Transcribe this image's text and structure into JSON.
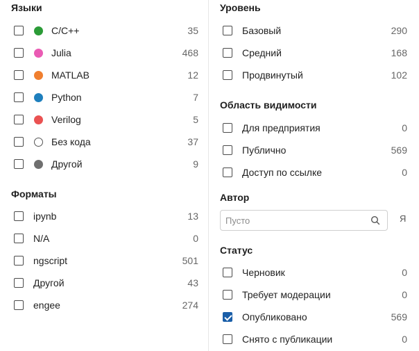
{
  "languages": {
    "title": "Языки",
    "items": [
      {
        "label": "C/C++",
        "count": "35",
        "color": "#2b9b37"
      },
      {
        "label": "Julia",
        "count": "468",
        "color": "#ea5bb4"
      },
      {
        "label": "MATLAB",
        "count": "12",
        "color": "#f07f2f"
      },
      {
        "label": "Python",
        "count": "7",
        "color": "#1e7fbd"
      },
      {
        "label": "Verilog",
        "count": "5",
        "color": "#ea5252"
      },
      {
        "label": "Без кода",
        "count": "37",
        "color": "#ffffff"
      },
      {
        "label": "Другой",
        "count": "9",
        "color": "#6f6f6f"
      }
    ]
  },
  "formats": {
    "title": "Форматы",
    "items": [
      {
        "label": "ipynb",
        "count": "13"
      },
      {
        "label": "N/A",
        "count": "0"
      },
      {
        "label": "ngscript",
        "count": "501"
      },
      {
        "label": "Другой",
        "count": "43"
      },
      {
        "label": "engee",
        "count": "274"
      }
    ]
  },
  "level": {
    "title": "Уровень",
    "items": [
      {
        "label": "Базовый",
        "count": "290"
      },
      {
        "label": "Средний",
        "count": "168"
      },
      {
        "label": "Продвинутый",
        "count": "102"
      }
    ]
  },
  "visibility": {
    "title": "Область видимости",
    "items": [
      {
        "label": "Для предприятия",
        "count": "0"
      },
      {
        "label": "Публично",
        "count": "569"
      },
      {
        "label": "Доступ по ссылке",
        "count": "0"
      }
    ]
  },
  "author": {
    "title": "Автор",
    "placeholder": "Пусто",
    "me_label": "Я"
  },
  "status": {
    "title": "Статус",
    "items": [
      {
        "label": "Черновик",
        "count": "0",
        "checked": false
      },
      {
        "label": "Требует модерации",
        "count": "0",
        "checked": false
      },
      {
        "label": "Опубликовано",
        "count": "569",
        "checked": true
      },
      {
        "label": "Снято с публикации",
        "count": "0",
        "checked": false
      }
    ]
  },
  "icons": {
    "search": "search-icon"
  },
  "colors": {
    "checkbox_checked": "#1a5ea8"
  }
}
